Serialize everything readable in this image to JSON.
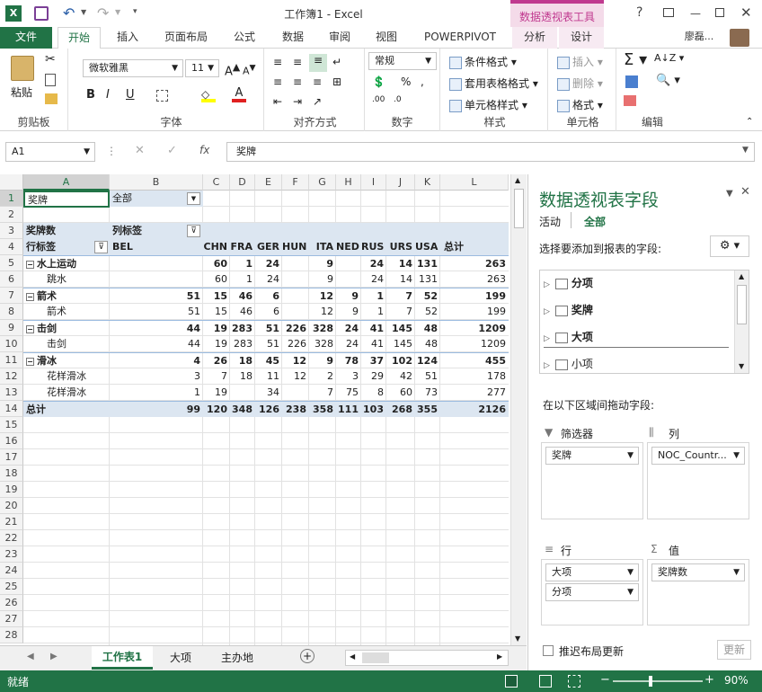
{
  "window": {
    "title": "工作簿1 - Excel",
    "context_tab": "数据透视表工具",
    "user": "廖磊..."
  },
  "ribbon_tabs": [
    "文件",
    "开始",
    "插入",
    "页面布局",
    "公式",
    "数据",
    "审阅",
    "视图",
    "POWERPIVOT",
    "分析",
    "设计"
  ],
  "ribbon": {
    "paste": "粘贴",
    "font_name": "微软雅黑",
    "font_size": "11",
    "number_format": "常规",
    "styles": [
      "条件格式",
      "套用表格格式",
      "单元格样式"
    ],
    "cells": [
      "插入",
      "删除",
      "格式"
    ],
    "groups": [
      "剪贴板",
      "字体",
      "对齐方式",
      "数字",
      "样式",
      "单元格",
      "编辑"
    ]
  },
  "formula_bar": {
    "name_box": "A1",
    "fx": "fx",
    "content": "奖牌"
  },
  "columns": [
    "A",
    "B",
    "C",
    "D",
    "E",
    "F",
    "G",
    "H",
    "I",
    "J",
    "K",
    "L"
  ],
  "rows": [
    "1",
    "2",
    "3",
    "4",
    "5",
    "6",
    "7",
    "8",
    "9",
    "10",
    "11",
    "12",
    "13",
    "14",
    "15",
    "16",
    "17",
    "18",
    "19",
    "20",
    "21",
    "22",
    "23",
    "24",
    "25",
    "26",
    "27",
    "28"
  ],
  "pivot": {
    "filter_label": "奖牌",
    "filter_value": "全部",
    "values_label": "奖牌数",
    "col_labels": "列标签",
    "row_labels": "行标签",
    "countries": [
      "BEL",
      "CHN",
      "FRA",
      "GER",
      "HUN",
      "ITA",
      "NED",
      "RUS",
      "URS",
      "USA"
    ],
    "total_label": "总计",
    "data": [
      {
        "label": "水上运动",
        "level": 0,
        "vals": [
          "",
          "60",
          "1",
          "24",
          "",
          "9",
          "",
          "24",
          "14",
          "131",
          "263"
        ]
      },
      {
        "label": "跳水",
        "level": 1,
        "vals": [
          "",
          "60",
          "1",
          "24",
          "",
          "9",
          "",
          "24",
          "14",
          "131",
          "263"
        ]
      },
      {
        "label": "箭术",
        "level": 0,
        "vals": [
          "51",
          "15",
          "46",
          "6",
          "",
          "12",
          "9",
          "1",
          "7",
          "52",
          "199"
        ]
      },
      {
        "label": "箭术",
        "level": 1,
        "vals": [
          "51",
          "15",
          "46",
          "6",
          "",
          "12",
          "9",
          "1",
          "7",
          "52",
          "199"
        ]
      },
      {
        "label": "击剑",
        "level": 0,
        "vals": [
          "44",
          "19",
          "283",
          "51",
          "226",
          "328",
          "24",
          "41",
          "145",
          "48",
          "1209"
        ]
      },
      {
        "label": "击剑",
        "level": 1,
        "vals": [
          "44",
          "19",
          "283",
          "51",
          "226",
          "328",
          "24",
          "41",
          "145",
          "48",
          "1209"
        ]
      },
      {
        "label": "滑冰",
        "level": 0,
        "vals": [
          "4",
          "26",
          "18",
          "45",
          "12",
          "9",
          "78",
          "37",
          "102",
          "124",
          "455"
        ]
      },
      {
        "label": "花样滑冰",
        "level": 1,
        "vals": [
          "3",
          "7",
          "18",
          "11",
          "12",
          "2",
          "3",
          "29",
          "42",
          "51",
          "178"
        ]
      },
      {
        "label": "花样滑冰",
        "level": 1,
        "vals": [
          "1",
          "19",
          "",
          "34",
          "",
          "7",
          "75",
          "8",
          "60",
          "73",
          "277"
        ]
      },
      {
        "label": "总计",
        "level": 2,
        "vals": [
          "99",
          "120",
          "348",
          "126",
          "238",
          "358",
          "111",
          "103",
          "268",
          "355",
          "2126"
        ]
      }
    ]
  },
  "sheet_tabs": [
    "工作表1",
    "大项",
    "主办地"
  ],
  "status": {
    "ready": "就绪",
    "zoom": "90%"
  },
  "pane": {
    "title": "数据透视表字段",
    "tab_active": "活动",
    "tab_all": "全部",
    "choose_label": "选择要添加到报表的字段:",
    "fields": [
      "分项",
      "奖牌",
      "大项",
      "小项"
    ],
    "drag_label": "在以下区域间拖动字段:",
    "zone_filter": "筛选器",
    "zone_columns": "列",
    "zone_rows": "行",
    "zone_values": "值",
    "filter_items": [
      "奖牌"
    ],
    "column_items": [
      "NOC_Countr..."
    ],
    "row_items": [
      "大项",
      "分项"
    ],
    "value_items": [
      "奖牌数"
    ],
    "defer_label": "推迟布局更新",
    "update_btn": "更新"
  },
  "colors": {
    "excel_green": "#217346",
    "pivot_blue": "#dce6f1",
    "context_pink": "#c0398f"
  }
}
